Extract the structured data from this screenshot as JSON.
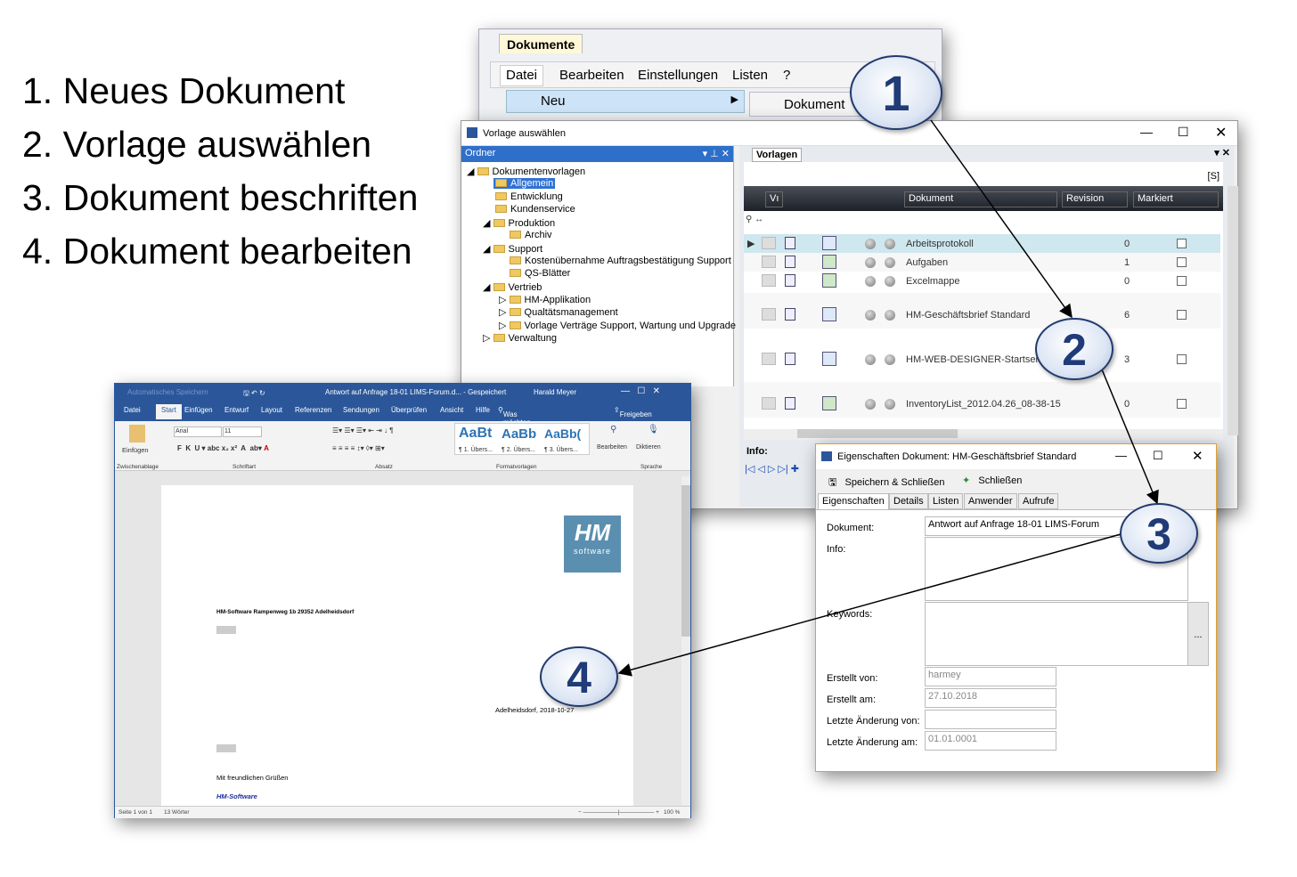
{
  "steps": [
    "1. Neues Dokument",
    "2. Vorlage auswählen",
    "3. Dokument beschriften",
    "4. Dokument bearbeiten"
  ],
  "dokumente": {
    "tab": "Dokumente",
    "menu": [
      "Datei",
      "Bearbeiten",
      "Einstellungen",
      "Listen",
      "?"
    ],
    "submenu": "Neu",
    "subitem": "Dokument"
  },
  "vorlage": {
    "title": "Vorlage auswählen",
    "ordner": "Ordner",
    "vorlagen_tab": "Vorlagen",
    "s_label": "[S]",
    "info_label": "Info:",
    "tree": [
      "Dokumentenvorlagen",
      "Allgemein",
      "Entwicklung",
      "Kundenservice",
      "Produktion",
      "Archiv",
      "Support",
      "Kostenübernahme Auftragsbestätigung Support",
      "QS-Blätter",
      "Vertrieb",
      "HM-Applikation",
      "Qualtätsmanagement",
      "Vorlage Verträge Support, Wartung und Upgrade",
      "Verwaltung"
    ],
    "columns": {
      "v": "Vı",
      "dokument": "Dokument",
      "revision": "Revision",
      "markiert": "Markiert"
    },
    "rows": [
      {
        "name": "Arbeitsprotokoll",
        "rev": "0"
      },
      {
        "name": "Aufgaben",
        "rev": "1"
      },
      {
        "name": "Excelmappe",
        "rev": "0"
      },
      {
        "name": "HM-Geschäftsbrief Standard",
        "rev": "6"
      },
      {
        "name": "HM-WEB-DESIGNER-Startseite",
        "rev": "3"
      },
      {
        "name": "InventoryList_2012.04.26_08-38-15",
        "rev": "0"
      }
    ]
  },
  "word": {
    "autosave": "Automatisches Speichern",
    "title": "Antwort auf Anfrage 18-01 LIMS-Forum.d...  -  Gespeichert",
    "user": "Harald Meyer",
    "tabs": [
      "Datei",
      "Start",
      "Einfügen",
      "Entwurf",
      "Layout",
      "Referenzen",
      "Sendungen",
      "Überprüfen",
      "Ansicht",
      "Hilfe"
    ],
    "search": "Was möchten Sie tun?",
    "share": "Freigeben",
    "ribbon": {
      "paste": "Einfügen",
      "font": "Arial",
      "size": "11",
      "styles": [
        "AaBt",
        "AaBb",
        "AaBb("
      ],
      "style_names": [
        "¶ 1. Übers...",
        "¶ 2. Übers...",
        "¶ 3. Übers..."
      ],
      "edit": "Bearbeiten",
      "dictate": "Diktieren",
      "groups": [
        "Zwischenablage",
        "Schriftart",
        "Absatz",
        "Formatvorlagen",
        "Sprache"
      ]
    },
    "doc": {
      "sender": "HM-Software  Rampenweg 1b  29352 Adelheidsdorf",
      "date": "Adelheidsdorf, 2018-10-27",
      "closing": "Mit freundlichen Grüßen",
      "signature": "HM-Software",
      "logo": "software"
    },
    "status": {
      "page": "Seite 1 von 1",
      "words": "13 Wörter",
      "zoom": "100 %"
    }
  },
  "dialog": {
    "title": "Eigenschaften Dokument: HM-Geschäftsbrief Standard",
    "save_close": "Speichern & Schließen",
    "close": "Schließen",
    "tabs": [
      "Eigenschaften",
      "Details",
      "Listen",
      "Anwender",
      "Aufrufe"
    ],
    "labels": {
      "dokument": "Dokument:",
      "info": "Info:",
      "keywords": "Keywords:",
      "erstellt_von": "Erstellt von:",
      "erstellt_am": "Erstellt am:",
      "letzte_von": "Letzte Änderung von:",
      "letzte_am": "Letzte Änderung am:"
    },
    "values": {
      "dokument": "Antwort auf Anfrage 18-01 LIMS-Forum",
      "erstellt_von": "harmey",
      "erstellt_am": "27.10.2018",
      "letzte_von": "",
      "letzte_am": "01.01.0001"
    },
    "ellipsis": "..."
  },
  "callouts": [
    "1",
    "2",
    "3",
    "4"
  ]
}
